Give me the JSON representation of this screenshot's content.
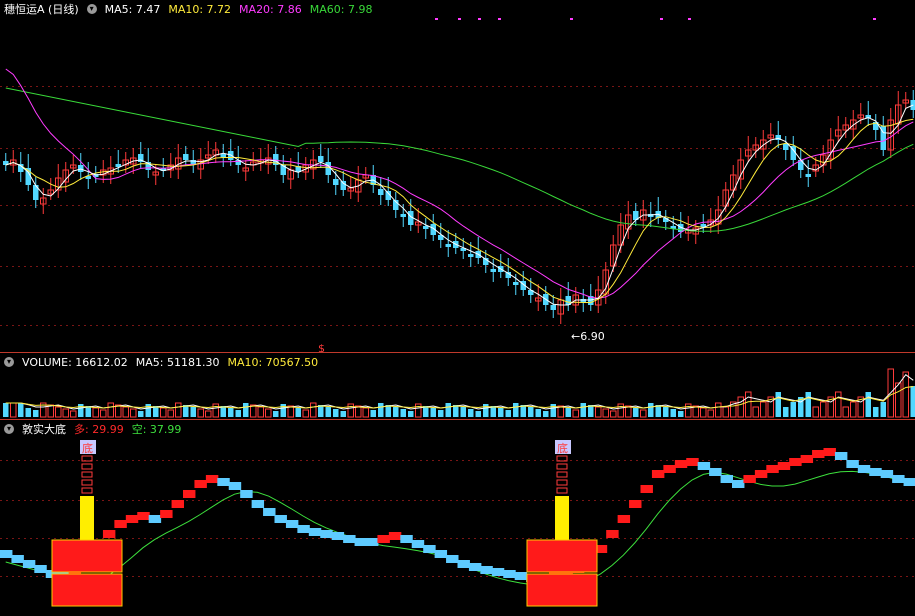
{
  "main": {
    "title": "穗恒运A (日线)",
    "ma": [
      {
        "label": "MA5: 7.47",
        "color": "#ffffff"
      },
      {
        "label": "MA10: 7.72",
        "color": "#ffeb3b"
      },
      {
        "label": "MA20: 7.86",
        "color": "#ff3cff"
      },
      {
        "label": "MA60: 7.98",
        "color": "#39d839"
      }
    ],
    "low_marker": "6.90",
    "signal_mark": "$"
  },
  "volume": {
    "labels": [
      {
        "label": "VOLUME: 16612.02",
        "color": "#ffffff"
      },
      {
        "label": "MA5: 51181.30",
        "color": "#ffffff"
      },
      {
        "label": "MA10: 70567.50",
        "color": "#ffeb3b"
      }
    ]
  },
  "indicator": {
    "name": "敦实大底",
    "duo": "多: 29.99",
    "kong": "空: 37.99",
    "bottom_char": "底",
    "duo_color": "#ff2a2a",
    "kong_color": "#3de03d"
  },
  "colors": {
    "up": "#ff3b3b",
    "down": "#52d8ff",
    "grid": "#8b1a1a"
  }
}
